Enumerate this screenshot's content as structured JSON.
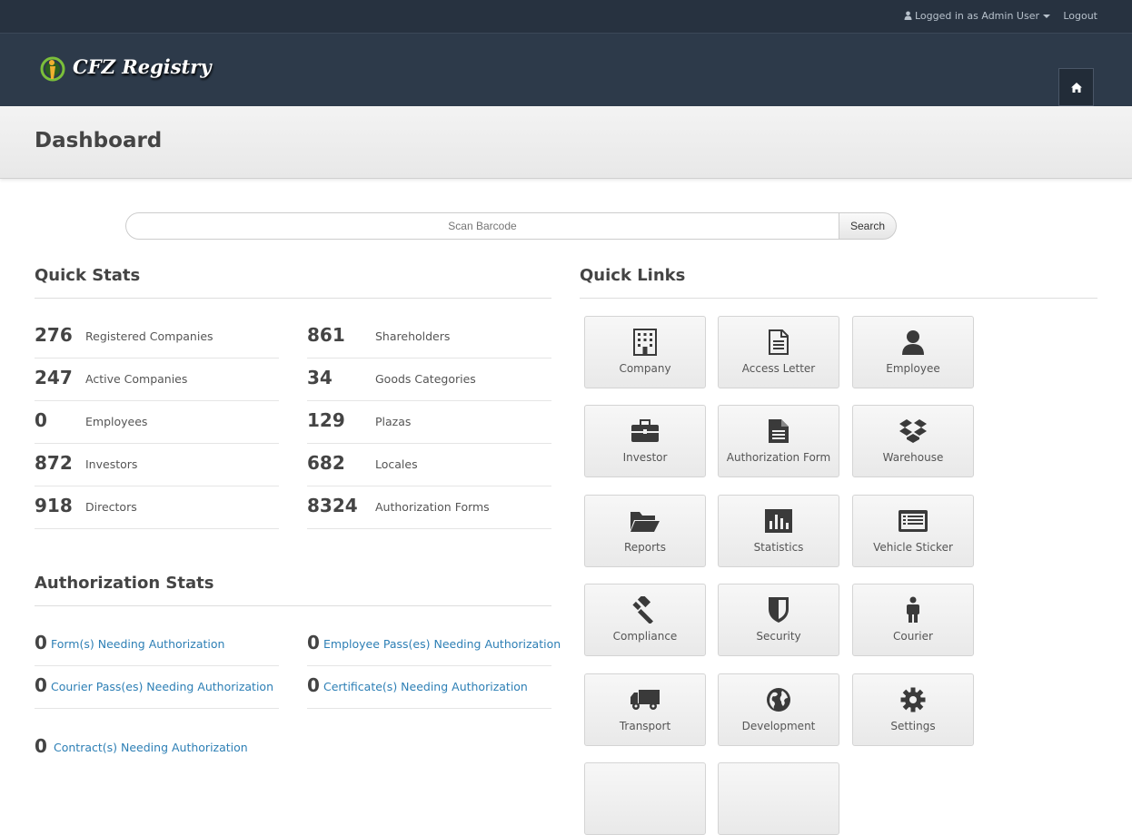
{
  "topbar": {
    "login_text": "Logged in as Admin User",
    "logout_label": "Logout"
  },
  "header": {
    "brand": "CFZ Registry"
  },
  "page": {
    "title": "Dashboard"
  },
  "search": {
    "placeholder": "Scan Barcode",
    "button_label": "Search"
  },
  "quick_stats": {
    "title": "Quick Stats",
    "left": [
      {
        "value": "276",
        "label": "Registered Companies"
      },
      {
        "value": "247",
        "label": "Active Companies"
      },
      {
        "value": "0",
        "label": "Employees"
      },
      {
        "value": "872",
        "label": "Investors"
      },
      {
        "value": "918",
        "label": "Directors"
      }
    ],
    "right": [
      {
        "value": "861",
        "label": "Shareholders"
      },
      {
        "value": "34",
        "label": "Goods Categories"
      },
      {
        "value": "129",
        "label": "Plazas"
      },
      {
        "value": "682",
        "label": "Locales"
      },
      {
        "value": "8324",
        "label": "Authorization Forms"
      }
    ]
  },
  "auth_stats": {
    "title": "Authorization Stats",
    "items": [
      {
        "value": "0",
        "label": "Form(s) Needing Authorization"
      },
      {
        "value": "0",
        "label": "Employee Pass(es) Needing Authorization"
      },
      {
        "value": "0",
        "label": "Courier Pass(es) Needing Authorization"
      },
      {
        "value": "0",
        "label": "Certificate(s) Needing Authorization"
      },
      {
        "value": "0",
        "label": "Contract(s) Needing Authorization"
      }
    ]
  },
  "quick_links": {
    "title": "Quick Links",
    "items": [
      {
        "label": "Company",
        "icon": "building-icon"
      },
      {
        "label": "Access Letter",
        "icon": "document-icon"
      },
      {
        "label": "Employee",
        "icon": "user-icon"
      },
      {
        "label": "Investor",
        "icon": "briefcase-icon"
      },
      {
        "label": "Authorization Form",
        "icon": "file-text-icon"
      },
      {
        "label": "Warehouse",
        "icon": "dropbox-icon"
      },
      {
        "label": "Reports",
        "icon": "folder-open-icon"
      },
      {
        "label": "Statistics",
        "icon": "bar-chart-icon"
      },
      {
        "label": "Vehicle Sticker",
        "icon": "list-alt-icon"
      },
      {
        "label": "Compliance",
        "icon": "gavel-icon"
      },
      {
        "label": "Security",
        "icon": "shield-icon"
      },
      {
        "label": "Courier",
        "icon": "male-icon"
      },
      {
        "label": "Transport",
        "icon": "truck-icon"
      },
      {
        "label": "Development",
        "icon": "globe-icon"
      },
      {
        "label": "Settings",
        "icon": "gear-icon"
      }
    ]
  },
  "colors": {
    "topbar": "#273240",
    "header": "#2d3a4a",
    "link": "#2d7fb5"
  }
}
